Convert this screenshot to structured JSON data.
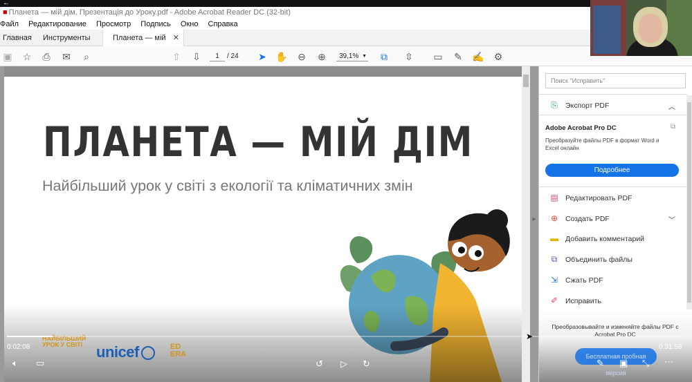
{
  "window": {
    "title": "Планета — мій дім. Презентація до Уроку.pdf - Adobe Acrobat Reader DC (32-bit)"
  },
  "menu": [
    "Файл",
    "Редактирование",
    "Просмотр",
    "Подпись",
    "Окно",
    "Справка"
  ],
  "tabs": {
    "home": "Главная",
    "tools": "Инструменты",
    "document": "Планета — мій дім..."
  },
  "toolbar": {
    "current_page": "1",
    "total_pages": "/ 24",
    "zoom": "39,1%"
  },
  "slide": {
    "title": "ПЛАНЕТА — МІЙ ДІМ",
    "subtitle": "Найбільший урок у світі з екології та кліматичних змін",
    "logo_lesson": "НАЙБІЛЬШИЙ УРОК У СВІТІ",
    "logo_unicef": "unicef",
    "logo_edera": "ED ERA"
  },
  "video": {
    "elapsed": "0:02:08",
    "duration": "0:31:58",
    "progress": 0.068
  },
  "right_panel": {
    "search_placeholder": "Поиск \"Исправить\"",
    "export_label": "Экспорт PDF",
    "promo_title": "Adobe Acrobat Pro DC",
    "promo_desc": "Преобразуйте файлы PDF в формат Word и Excel онлайн",
    "promo_button": "Подробнее",
    "tools": [
      {
        "label": "Редактировать PDF",
        "icon": "edit-pdf-icon"
      },
      {
        "label": "Создать PDF",
        "icon": "create-pdf-icon"
      },
      {
        "label": "Добавить комментарий",
        "icon": "comment-icon"
      },
      {
        "label": "Объединить файлы",
        "icon": "combine-icon"
      },
      {
        "label": "Сжать PDF",
        "icon": "compress-icon"
      },
      {
        "label": "Исправить",
        "icon": "fix-icon"
      }
    ],
    "bottom_text": "Преобразовывайте и изменяйте файлы PDF с Acrobat Pro DC",
    "trial_button": "Бесплатная пробная версия"
  }
}
